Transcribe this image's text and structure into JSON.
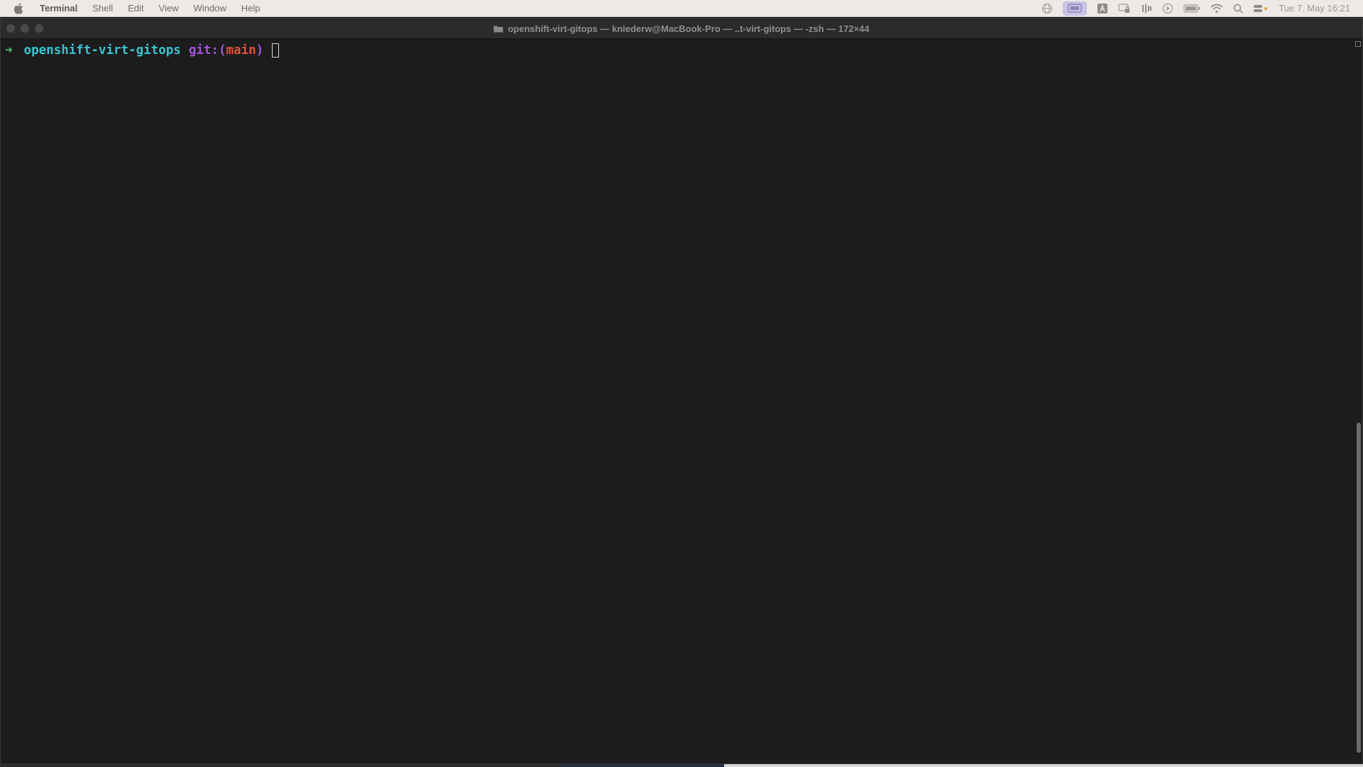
{
  "menubar": {
    "apple_icon": "apple-logo-icon",
    "app_name": "Terminal",
    "items": [
      "Shell",
      "Edit",
      "View",
      "Window",
      "Help"
    ],
    "status_icons": [
      "globe-icon",
      "screen-share-icon",
      "text-input-icon",
      "lock-display-icon",
      "audio-bars-icon",
      "play-circle-icon",
      "battery-icon",
      "wifi-icon",
      "search-icon",
      "control-center-icon"
    ],
    "clock": "Tue 7. May  16:21"
  },
  "window": {
    "title": "openshift-virt-gitops — kniederw@MacBook-Pro — ..t-virt-gitops — -zsh — 172×44",
    "folder_icon": "folder-icon"
  },
  "terminal": {
    "arrow": "➜",
    "directory": "openshift-virt-gitops",
    "git_label": "git:",
    "paren_open": "(",
    "branch": "main",
    "paren_close": ")"
  },
  "colors": {
    "background": "#1c1c1c",
    "arrow": "#4fc36b",
    "directory": "#38c4d0",
    "git": "#a653e0",
    "branch": "#e2523a"
  }
}
